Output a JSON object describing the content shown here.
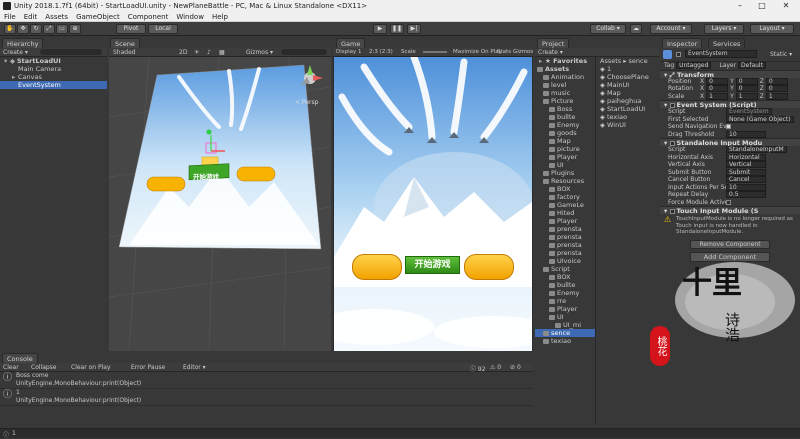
{
  "window": {
    "title": "Unity 2018.1.7f1 (64bit) - StartLoadUI.unity - NewPlaneBattle - PC, Mac & Linux Standalone <DX11>"
  },
  "menu": [
    "File",
    "Edit",
    "Assets",
    "GameObject",
    "Component",
    "Window",
    "Help"
  ],
  "toolbar": {
    "pivot": "Pivot",
    "local": "Local",
    "collab": "Collab ▾",
    "account": "Account ▾",
    "layers": "Layers ▾",
    "layout": "Layout ▾"
  },
  "hierarchy": {
    "tab": "Hierarchy",
    "create": "Create ▾",
    "search": "",
    "items": [
      {
        "label": "StartLoadUI",
        "level": 0,
        "expanded": true
      },
      {
        "label": "Main Camera",
        "level": 1
      },
      {
        "label": "Canvas",
        "level": 1,
        "collapsed": true
      },
      {
        "label": "EventSystem",
        "level": 1,
        "selected": true
      }
    ]
  },
  "scene": {
    "tab": "Scene",
    "shaded": "Shaded",
    "mode2d": "2D",
    "gizmos": "Gizmos ▾",
    "persp": "< Persp",
    "button_text": "开始游戏"
  },
  "game": {
    "tab": "Game",
    "display": "Display 1",
    "aspect": "2:3 (2:3)",
    "scale": "Scale",
    "maximize": "Maximize On Play",
    "mute": "Mute",
    "stats": "Stats",
    "gizmos": "Gizmos",
    "button_text": "开始游戏"
  },
  "project": {
    "tab": "Project",
    "create": "Create ▾",
    "favorites": "Favorites",
    "breadcrumb": "Assets ▸ sence",
    "tree": [
      {
        "label": "Assets",
        "level": 0,
        "bold": true
      },
      {
        "label": "Animation",
        "level": 1
      },
      {
        "label": "level",
        "level": 1
      },
      {
        "label": "music",
        "level": 1
      },
      {
        "label": "Picture",
        "level": 1
      },
      {
        "label": "Boss",
        "level": 2
      },
      {
        "label": "bullte",
        "level": 2
      },
      {
        "label": "Enemy",
        "level": 2
      },
      {
        "label": "goods",
        "level": 2
      },
      {
        "label": "Map",
        "level": 2
      },
      {
        "label": "picture",
        "level": 2
      },
      {
        "label": "Player",
        "level": 2
      },
      {
        "label": "UI",
        "level": 2
      },
      {
        "label": "Plugins",
        "level": 1
      },
      {
        "label": "Resources",
        "level": 1
      },
      {
        "label": "BOX",
        "level": 2
      },
      {
        "label": "factory",
        "level": 2
      },
      {
        "label": "GameLe",
        "level": 2
      },
      {
        "label": "Hited",
        "level": 2
      },
      {
        "label": "Player",
        "level": 2
      },
      {
        "label": "prensta",
        "level": 2
      },
      {
        "label": "prensta",
        "level": 2
      },
      {
        "label": "prensta",
        "level": 2
      },
      {
        "label": "prensta",
        "level": 2
      },
      {
        "label": "UIvoice",
        "level": 2
      },
      {
        "label": "Script",
        "level": 1
      },
      {
        "label": "BOX",
        "level": 2
      },
      {
        "label": "bullte",
        "level": 2
      },
      {
        "label": "Enemy",
        "level": 2
      },
      {
        "label": "rre",
        "level": 2
      },
      {
        "label": "Player",
        "level": 2
      },
      {
        "label": "UI",
        "level": 2
      },
      {
        "label": "UI_mi",
        "level": 3
      },
      {
        "label": "sence",
        "level": 1,
        "selected": true
      },
      {
        "label": "texiao",
        "level": 1
      }
    ],
    "files": [
      "1",
      "ChoosePlane",
      "MainUI",
      "Map",
      "paiheghua",
      "StartLoadUI",
      "texiao",
      "WinUI"
    ]
  },
  "inspector": {
    "tab": "Inspector",
    "tab2": "Services",
    "object_name": "EventSystem",
    "static": "Static ▾",
    "tag_label": "Tag",
    "tag_value": "Untagged",
    "layer_label": "Layer",
    "layer_value": "Default",
    "transform": {
      "header": "Transform",
      "rows": [
        {
          "label": "Position",
          "x": "0",
          "y": "0",
          "z": "0"
        },
        {
          "label": "Rotation",
          "x": "0",
          "y": "0",
          "z": "0"
        },
        {
          "label": "Scale",
          "x": "1",
          "y": "1",
          "z": "1"
        }
      ]
    },
    "event_system": {
      "header": "Event System (Script)",
      "script_label": "Script",
      "script_value": "EventSystem",
      "first_selected_label": "First Selected",
      "first_selected_value": "None (Game Object)",
      "send_nav_label": "Send Navigation Eve",
      "drag_label": "Drag Threshold",
      "drag_value": "10"
    },
    "standalone": {
      "header": "Standalone Input Modu",
      "rows": [
        {
          "label": "Script",
          "value": "StandaloneInputM"
        },
        {
          "label": "Horizontal Axis",
          "value": "Horizontal"
        },
        {
          "label": "Vertical Axis",
          "value": "Vertical"
        },
        {
          "label": "Submit Button",
          "value": "Submit"
        },
        {
          "label": "Cancel Button",
          "value": "Cancel"
        },
        {
          "label": "Input Actions Per Se",
          "value": "10"
        },
        {
          "label": "Repeat Delay",
          "value": "0.5"
        },
        {
          "label": "Force Module Active",
          "value": ""
        }
      ]
    },
    "touch": {
      "header": "Touch Input Module (S",
      "warning": "TouchInputModule is no longer required as Touch input is now handled in StandaloneInputModule.",
      "remove": "Remove Component",
      "add": "Add Component"
    }
  },
  "console": {
    "tab": "Console",
    "buttons": [
      "Clear",
      "Collapse",
      "Clear on Play",
      "Error Pause",
      "Editor ▾"
    ],
    "counts": [
      "92",
      "0",
      "0"
    ],
    "entries": [
      {
        "line1": "Boss come",
        "line2": "UnityEngine.MonoBehaviour:print(Object)"
      },
      {
        "line1": "1",
        "line2": "UnityEngine.MonoBehaviour:print(Object)"
      }
    ],
    "status": "1"
  },
  "watermark": {
    "big": "十里",
    "small": "诗浩",
    "seal": "桃花"
  }
}
